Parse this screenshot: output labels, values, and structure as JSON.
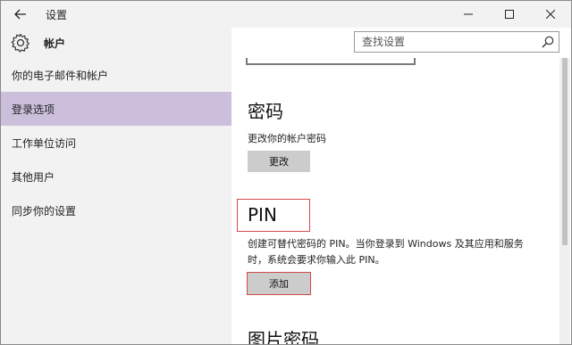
{
  "window": {
    "title": "设置",
    "back_icon": "back-arrow-icon",
    "controls": [
      "minimize-icon",
      "maximize-icon",
      "close-icon"
    ]
  },
  "sidebar": {
    "heading": "帐户",
    "heading_icon": "gear-icon",
    "items": [
      {
        "label": "你的电子邮件和帐户",
        "active": false
      },
      {
        "label": "登录选项",
        "active": true
      },
      {
        "label": "工作单位访问",
        "active": false
      },
      {
        "label": "其他用户",
        "active": false
      },
      {
        "label": "同步你的设置",
        "active": false
      }
    ]
  },
  "search": {
    "placeholder": "查找设置",
    "icon": "search-icon"
  },
  "content": {
    "password": {
      "title": "密码",
      "description": "更改你的帐户密码",
      "button": "更改"
    },
    "pin": {
      "title": "PIN",
      "description_line1": "创建可替代密码的 PIN。当你登录到 Windows 及其应用和服务",
      "description_line2": "时，系统会要求你输入此 PIN。",
      "button": "添加"
    },
    "picture_password": {
      "title": "图片密码"
    }
  },
  "colors": {
    "sidebar_bg": "#f2f2f2",
    "active_item_bg": "#cbbfdc",
    "highlight": "#d24a4a",
    "button_bg": "#cccccc"
  }
}
